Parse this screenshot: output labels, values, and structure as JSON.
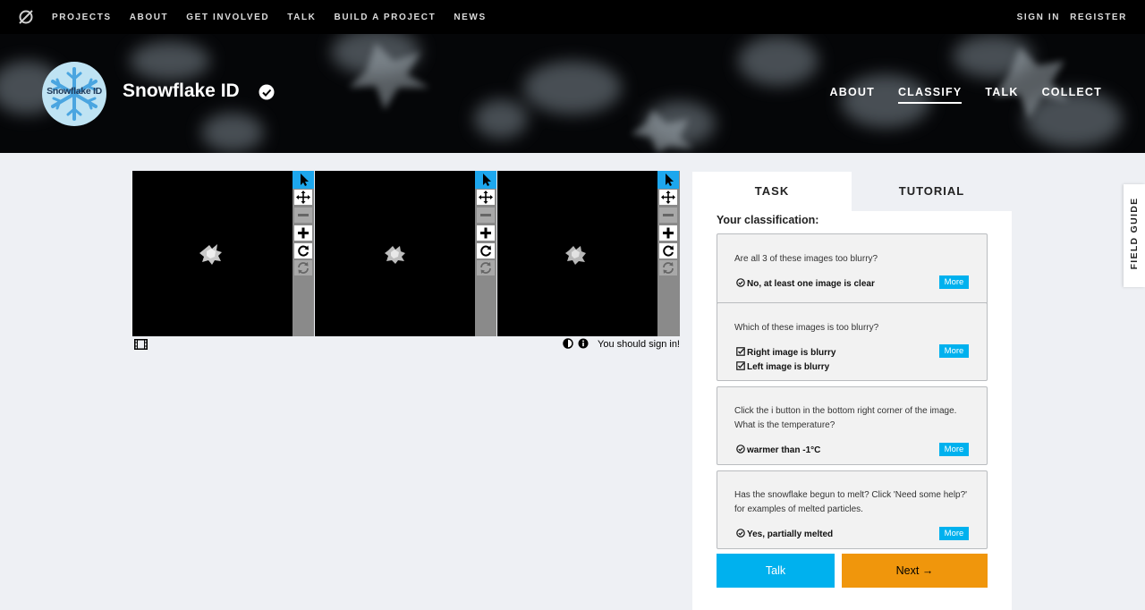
{
  "top_nav": {
    "items": [
      "PROJECTS",
      "ABOUT",
      "GET INVOLVED",
      "TALK",
      "BUILD A PROJECT",
      "NEWS"
    ],
    "sign_in": "SIGN IN",
    "register": "REGISTER"
  },
  "project": {
    "avatar_text": "Snowflake ID",
    "title": "Snowflake ID",
    "nav": [
      "ABOUT",
      "CLASSIFY",
      "TALK",
      "COLLECT"
    ],
    "active_nav": "CLASSIFY"
  },
  "subject_viewer": {
    "frame_count": 3,
    "tool_icons": [
      "pointer-icon",
      "move-icon",
      "zoom-out-icon",
      "zoom-in-icon",
      "rotate-icon",
      "reset-icon"
    ],
    "sign_in_notice": "You should sign in!"
  },
  "panel": {
    "tabs": [
      "TASK",
      "TUTORIAL"
    ],
    "active_tab": "TASK",
    "heading": "Your classification:",
    "questions": [
      {
        "question": "Are all 3 of these images too blurry?",
        "answers": [
          "No, at least one image is clear"
        ],
        "more": "More"
      },
      {
        "question": "Which of these images is too blurry?",
        "answers": [
          "Right image is blurry",
          "Left image is blurry"
        ],
        "more": "More"
      },
      {
        "question": "Click the i button in the bottom right corner of the image. What is the temperature?",
        "answers": [
          "warmer than -1°C"
        ],
        "more": "More"
      },
      {
        "question": "Has the snowflake begun to melt? Click 'Need some help?' for examples of melted particles.",
        "answers": [
          "Yes, partially melted"
        ],
        "more": "More"
      }
    ],
    "talk_button": "Talk",
    "next_button": "Next →"
  },
  "field_guide": "FIELD GUIDE",
  "colors": {
    "accent_blue": "#00b1ee",
    "next_orange": "#f0960c",
    "tool_selected": "#1da7ee"
  }
}
